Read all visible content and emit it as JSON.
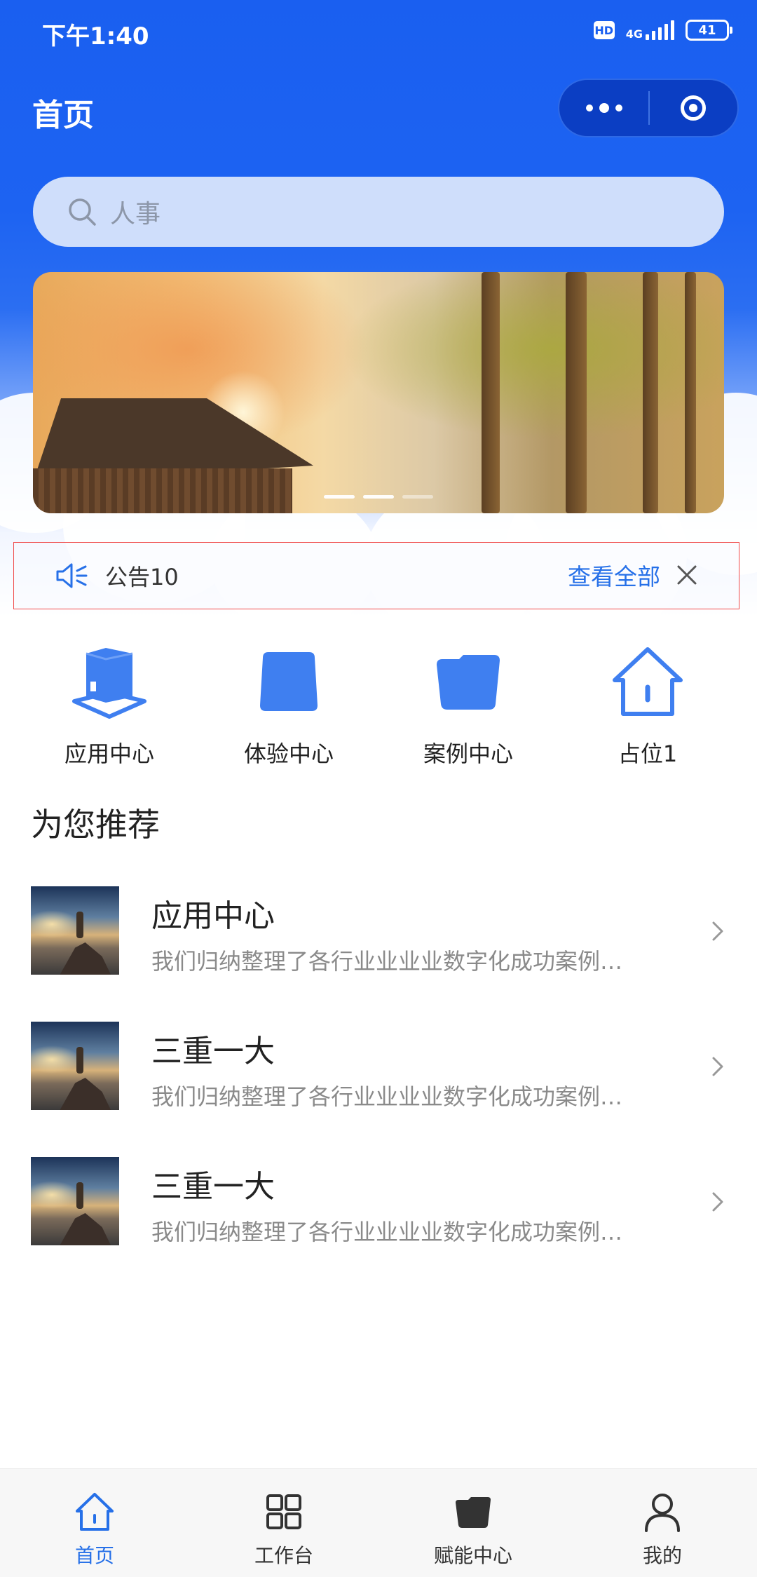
{
  "status_bar": {
    "time": "下午1:40",
    "hd_badge": "HD",
    "network": "4G",
    "battery": "41"
  },
  "nav": {
    "title": "首页",
    "capsule": {
      "more_icon": "more-dots-icon",
      "close_icon": "target-circle-icon"
    }
  },
  "search": {
    "placeholder": "人事",
    "icon": "search-icon"
  },
  "banner": {
    "slide_count": 3,
    "active_indices": [
      0,
      1
    ]
  },
  "notice": {
    "icon": "speaker-icon",
    "text": "公告10",
    "view_all": "查看全部",
    "close_icon": "close-icon"
  },
  "quick_entries": [
    {
      "label": "应用中心",
      "icon": "app-center-icon"
    },
    {
      "label": "体验中心",
      "icon": "experience-center-icon"
    },
    {
      "label": "案例中心",
      "icon": "case-center-icon"
    },
    {
      "label": "占位1",
      "icon": "home-icon"
    }
  ],
  "recommend": {
    "title": "为您推荐",
    "items": [
      {
        "title": "应用中心",
        "desc": "我们归纳整理了各行业业业业数字化成功案例…"
      },
      {
        "title": "三重一大",
        "desc": "我们归纳整理了各行业业业业数字化成功案例…"
      },
      {
        "title": "三重一大",
        "desc": "我们归纳整理了各行业业业业数字化成功案例…"
      }
    ]
  },
  "tabbar": {
    "active": 0,
    "tabs": [
      {
        "label": "首页",
        "icon": "home-icon"
      },
      {
        "label": "工作台",
        "icon": "grid-icon"
      },
      {
        "label": "赋能中心",
        "icon": "folder-icon"
      },
      {
        "label": "我的",
        "icon": "user-icon"
      }
    ]
  },
  "colors": {
    "primary": "#1a5ff0",
    "accent": "#2670e8",
    "notice_border": "#f04a4a"
  }
}
